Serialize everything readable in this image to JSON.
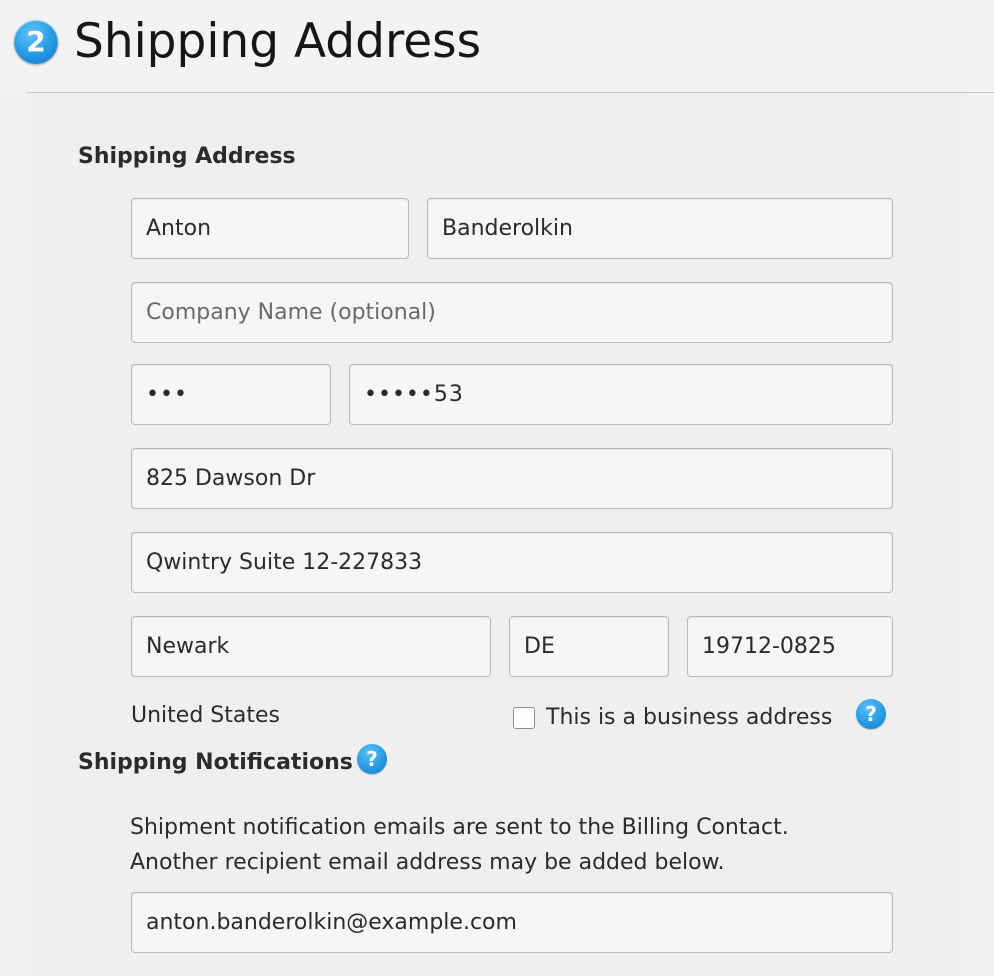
{
  "header": {
    "step_number": "2",
    "title": "Shipping Address"
  },
  "shipping_address": {
    "section_title": "Shipping Address",
    "first_name": "Anton",
    "last_name": "Banderolkin",
    "company_placeholder": "Company Name (optional)",
    "phone_prefix_masked": "•••",
    "phone_masked": "•••••53",
    "address_line1": "825 Dawson Dr",
    "address_line2": "Qwintry Suite 12-227833",
    "city": "Newark",
    "state": "DE",
    "zip": "19712-0825",
    "country": "United States",
    "business_checkbox_label": "This is a business address",
    "business_checkbox_checked": false
  },
  "shipping_notifications": {
    "section_title": "Shipping Notifications",
    "note_line1": "Shipment notification emails are sent to the Billing Contact.",
    "note_line2": "Another recipient email address may be added below.",
    "email": "anton.banderolkin@example.com"
  },
  "icons": {
    "help": "?"
  },
  "colors": {
    "accent_blue": "#2599e3",
    "background": "#f1f1f1",
    "field_border": "#b9b9b9"
  }
}
